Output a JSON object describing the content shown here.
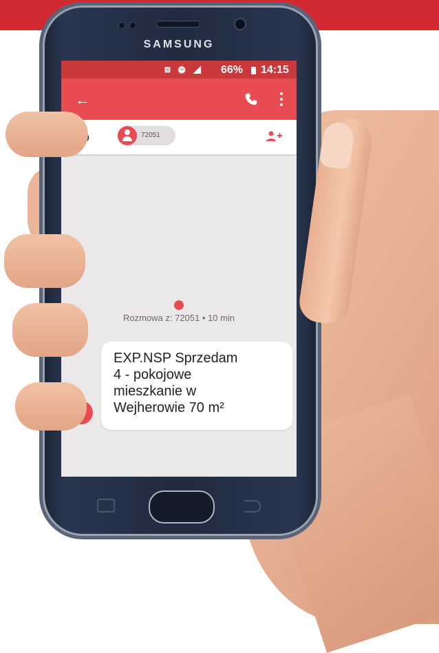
{
  "device": {
    "brand": "SAMSUNG"
  },
  "status_bar": {
    "icons": "⧈ ⏰ ◢",
    "battery": "66%",
    "time": "14:15"
  },
  "app_bar": {
    "back_icon": "arrow-left-icon",
    "call_icon": "phone-icon",
    "menu_icon": "more-vert-icon"
  },
  "recipient": {
    "label": "Do",
    "chip": "72051",
    "add_icon": "add-person-icon"
  },
  "conversation": {
    "info": "Rozmowa z: 72051 • 10 min"
  },
  "message": {
    "lines": [
      "EXP.NSP Sprzedam",
      "4 - pokojowe",
      "mieszkanie w",
      "Wejherowie 70 m²"
    ],
    "avatar_glyph": "+"
  },
  "colors": {
    "accent": "#e94b52",
    "status_bar": "#c9393c",
    "screen_bg": "#ebe8ea",
    "top_band": "#d12a33"
  }
}
